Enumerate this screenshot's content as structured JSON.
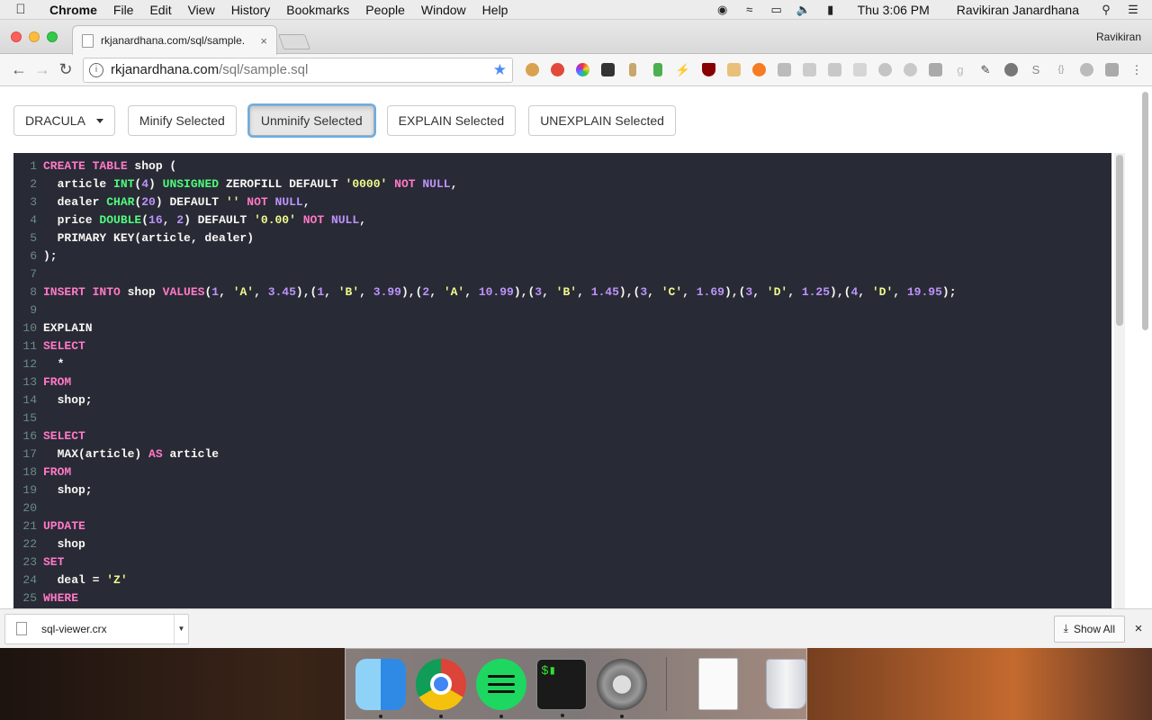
{
  "menubar": {
    "app": "Chrome",
    "items": [
      "File",
      "Edit",
      "View",
      "History",
      "Bookmarks",
      "People",
      "Window",
      "Help"
    ],
    "clock": "Thu 3:06 PM",
    "user": "Ravikiran Janardhana"
  },
  "browser": {
    "tab_title": "rkjanardhana.com/sql/sample.",
    "profile": "Ravikiran",
    "url_host": "rkjanardhana.com",
    "url_path": "/sql/sample.sql"
  },
  "toolbar": {
    "theme": "DRACULA",
    "minify": "Minify Selected",
    "unminify": "Unminify Selected",
    "explain": "EXPLAIN Selected",
    "unexplain": "UNEXPLAIN Selected"
  },
  "code_lines": [
    [
      [
        "k",
        "CREATE TABLE"
      ],
      [
        "t",
        " shop ("
      ]
    ],
    [
      [
        "t",
        "  article "
      ],
      [
        "f",
        "INT"
      ],
      [
        "t",
        "("
      ],
      [
        "n",
        "4"
      ],
      [
        "t",
        ") "
      ],
      [
        "f",
        "UNSIGNED"
      ],
      [
        "t",
        " ZEROFILL DEFAULT "
      ],
      [
        "s",
        "'0000'"
      ],
      [
        "t",
        " "
      ],
      [
        "k",
        "NOT"
      ],
      [
        "t",
        " "
      ],
      [
        "n",
        "NULL"
      ],
      [
        "t",
        ","
      ]
    ],
    [
      [
        "t",
        "  dealer "
      ],
      [
        "f",
        "CHAR"
      ],
      [
        "t",
        "("
      ],
      [
        "n",
        "20"
      ],
      [
        "t",
        ") DEFAULT "
      ],
      [
        "s",
        "''"
      ],
      [
        "t",
        " "
      ],
      [
        "k",
        "NOT"
      ],
      [
        "t",
        " "
      ],
      [
        "n",
        "NULL"
      ],
      [
        "t",
        ","
      ]
    ],
    [
      [
        "t",
        "  price "
      ],
      [
        "f",
        "DOUBLE"
      ],
      [
        "t",
        "("
      ],
      [
        "n",
        "16"
      ],
      [
        "t",
        ", "
      ],
      [
        "n",
        "2"
      ],
      [
        "t",
        ") DEFAULT "
      ],
      [
        "s",
        "'0.00'"
      ],
      [
        "t",
        " "
      ],
      [
        "k",
        "NOT"
      ],
      [
        "t",
        " "
      ],
      [
        "n",
        "NULL"
      ],
      [
        "t",
        ","
      ]
    ],
    [
      [
        "t",
        "  PRIMARY KEY(article, dealer)"
      ]
    ],
    [
      [
        "t",
        ");"
      ]
    ],
    [],
    [
      [
        "k",
        "INSERT INTO"
      ],
      [
        "t",
        " shop "
      ],
      [
        "k",
        "VALUES"
      ],
      [
        "t",
        "("
      ],
      [
        "n",
        "1"
      ],
      [
        "t",
        ", "
      ],
      [
        "s",
        "'A'"
      ],
      [
        "t",
        ", "
      ],
      [
        "n",
        "3.45"
      ],
      [
        "t",
        "),("
      ],
      [
        "n",
        "1"
      ],
      [
        "t",
        ", "
      ],
      [
        "s",
        "'B'"
      ],
      [
        "t",
        ", "
      ],
      [
        "n",
        "3.99"
      ],
      [
        "t",
        "),("
      ],
      [
        "n",
        "2"
      ],
      [
        "t",
        ", "
      ],
      [
        "s",
        "'A'"
      ],
      [
        "t",
        ", "
      ],
      [
        "n",
        "10.99"
      ],
      [
        "t",
        "),("
      ],
      [
        "n",
        "3"
      ],
      [
        "t",
        ", "
      ],
      [
        "s",
        "'B'"
      ],
      [
        "t",
        ", "
      ],
      [
        "n",
        "1.45"
      ],
      [
        "t",
        "),("
      ],
      [
        "n",
        "3"
      ],
      [
        "t",
        ", "
      ],
      [
        "s",
        "'C'"
      ],
      [
        "t",
        ", "
      ],
      [
        "n",
        "1.69"
      ],
      [
        "t",
        "),("
      ],
      [
        "n",
        "3"
      ],
      [
        "t",
        ", "
      ],
      [
        "s",
        "'D'"
      ],
      [
        "t",
        ", "
      ],
      [
        "n",
        "1.25"
      ],
      [
        "t",
        "),("
      ],
      [
        "n",
        "4"
      ],
      [
        "t",
        ", "
      ],
      [
        "s",
        "'D'"
      ],
      [
        "t",
        ", "
      ],
      [
        "n",
        "19.95"
      ],
      [
        "t",
        ");"
      ]
    ],
    [],
    [
      [
        "t",
        "EXPLAIN"
      ]
    ],
    [
      [
        "k",
        "SELECT"
      ]
    ],
    [
      [
        "t",
        "  *"
      ]
    ],
    [
      [
        "k",
        "FROM"
      ]
    ],
    [
      [
        "t",
        "  shop;"
      ]
    ],
    [],
    [
      [
        "k",
        "SELECT"
      ]
    ],
    [
      [
        "t",
        "  MAX(article) "
      ],
      [
        "k",
        "AS"
      ],
      [
        "t",
        " article"
      ]
    ],
    [
      [
        "k",
        "FROM"
      ]
    ],
    [
      [
        "t",
        "  shop;"
      ]
    ],
    [],
    [
      [
        "k",
        "UPDATE"
      ]
    ],
    [
      [
        "t",
        "  shop"
      ]
    ],
    [
      [
        "k",
        "SET"
      ]
    ],
    [
      [
        "t",
        "  deal = "
      ],
      [
        "s",
        "'Z'"
      ]
    ],
    [
      [
        "k",
        "WHERE"
      ]
    ]
  ],
  "download": {
    "file": "sql-viewer.crx",
    "show_all": "Show All"
  },
  "colors": {
    "editor_bg": "#282a36",
    "keyword": "#ff79c6",
    "string": "#f1fa8c",
    "number": "#bd93f9",
    "type": "#50fa7b",
    "text": "#f8f8f2"
  }
}
